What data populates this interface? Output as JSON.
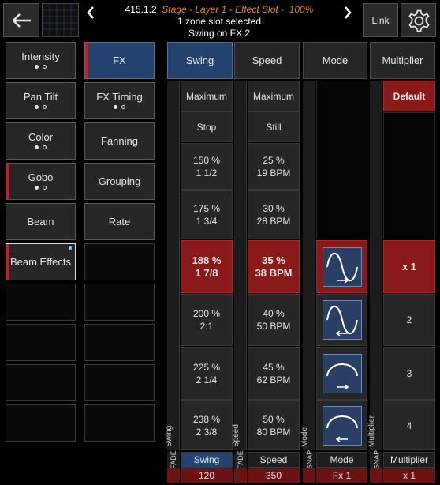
{
  "header": {
    "id": "415.1.2",
    "title": "Stage - Layer 1 - Effect Slot -",
    "percent": "100%",
    "line2": "1 zone slot selected",
    "line3": "Swing on FX 2",
    "link_label": "Link"
  },
  "categories_left": [
    {
      "label": "Intensity",
      "dots": [
        "f",
        "o"
      ],
      "red": false
    },
    {
      "label": "Pan Tilt",
      "dots": [
        "f",
        "o"
      ],
      "red": false
    },
    {
      "label": "Color",
      "dots": [
        "f",
        "o"
      ],
      "red": false
    },
    {
      "label": "Gobo",
      "dots": [
        "f",
        "o"
      ],
      "red": true
    },
    {
      "label": "Beam",
      "dots": [],
      "red": false
    },
    {
      "label": "Beam Effects",
      "dots": [],
      "red": true
    }
  ],
  "categories_right": [
    {
      "label": "FX",
      "selected": true,
      "red": true
    },
    {
      "label": "FX Timing",
      "dots": [
        "f",
        "o"
      ]
    },
    {
      "label": "Fanning"
    },
    {
      "label": "Grouping"
    },
    {
      "label": "Rate"
    }
  ],
  "columns": {
    "swing": {
      "header": "Swing",
      "side_label": "Swing",
      "fade_label": "FADE",
      "footer_name": "Swing",
      "footer_value": "120",
      "cells": [
        {
          "l1": "Maximum",
          "l2": ""
        },
        {
          "l1": "Stop",
          "l2": ""
        },
        {
          "l1": "150 %",
          "l2": "1 1/2"
        },
        {
          "l1": "175 %",
          "l2": "1 3/4"
        },
        {
          "l1": "188 %",
          "l2": "1 7/8"
        },
        {
          "l1": "200 %",
          "l2": "2:1"
        },
        {
          "l1": "225 %",
          "l2": "2 1/4"
        },
        {
          "l1": "238 %",
          "l2": "2 3/8"
        }
      ]
    },
    "speed": {
      "header": "Speed",
      "side_label": "Speed",
      "fade_label": "FADE",
      "footer_name": "Speed",
      "footer_value": "350",
      "cells": [
        {
          "l1": "Maximum",
          "l2": ""
        },
        {
          "l1": "Still",
          "l2": ""
        },
        {
          "l1": "25 %",
          "l2": "19 BPM"
        },
        {
          "l1": "30 %",
          "l2": "28 BPM"
        },
        {
          "l1": "35 %",
          "l2": "38 BPM"
        },
        {
          "l1": "40 %",
          "l2": "50 BPM"
        },
        {
          "l1": "45 %",
          "l2": "62 BPM"
        },
        {
          "l1": "50 %",
          "l2": "80 BPM"
        }
      ]
    },
    "mode": {
      "header": "Mode",
      "side_label": "Mode",
      "snap_label": "SNAP",
      "footer_name": "Mode",
      "footer_value": "Fx 1",
      "waves": [
        "sine-right",
        "sine-left",
        "arc-right",
        "arc-left"
      ]
    },
    "multiplier": {
      "header": "Multiplier",
      "side_label": "Multiplier",
      "snap_label": "SNAP",
      "footer_name": "Multiplier",
      "footer_value": "x 1",
      "default_label": "Default",
      "cells": [
        "x 1",
        "2",
        "3",
        "4"
      ]
    }
  },
  "colors": {
    "selected_blue": "#24426e",
    "active_red": "#8a1a1a",
    "marker_red": "#c61d1d",
    "title_orange": "#e08a00"
  }
}
